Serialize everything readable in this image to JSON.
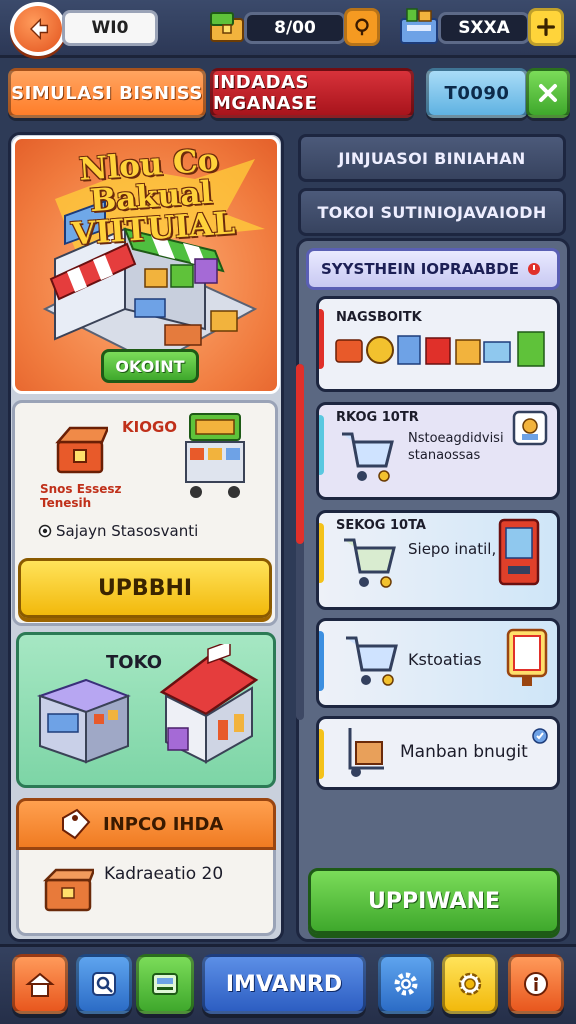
{
  "top_bar": {
    "player_label": "WI0",
    "resource_1_value": "8/00",
    "resource_2_value": "SXXA"
  },
  "tabs": {
    "tab_1": "SIMULASI BISNISS",
    "tab_2": "INDADAS MGANASE",
    "tab_3": "T0090"
  },
  "hero": {
    "title": "Nlou Co Bakual VIITUIAL",
    "button": "OKOINT"
  },
  "shop_card": {
    "title": "KIOGO",
    "item_caption": "Snos Essesz Tenesih",
    "info_line": "Sajayn Stasosvanti",
    "upgrade_button": "UPBBHI"
  },
  "store_card": {
    "title": "TOKO"
  },
  "info_card": {
    "title": "INPCO IHDA",
    "line": "Kadraeatio 20"
  },
  "right_menu": {
    "button_1": "JINJUASOI BINIAHAN",
    "button_2": "TOKOI SUTINIOJAVAIODH"
  },
  "upgrade_panel": {
    "header": "SYYSTHEIN IOPRAABDE",
    "items": [
      {
        "title": "NAGSBOITK",
        "desc": ""
      },
      {
        "title": "RKOG 10TR",
        "desc": "Nstoeagdidvisi stanaossas"
      },
      {
        "title": "SEKOG 10TA",
        "desc": "Siepo inatil,"
      },
      {
        "title": "",
        "desc": "Kstoatias"
      },
      {
        "title": "",
        "desc": "Manban bnugit"
      }
    ],
    "action_button": "UPPIWANE"
  },
  "bottom_nav": {
    "center_label": "IMVANRD"
  },
  "colors": {
    "tab_1": "#ff8a3d",
    "tab_2": "#c8202a",
    "tab_3": "#7ec8f0",
    "close": "#5fc23a",
    "accent_red": "#e0302a",
    "accent_blue": "#3d8fe0",
    "accent_yellow": "#f4c21a"
  }
}
